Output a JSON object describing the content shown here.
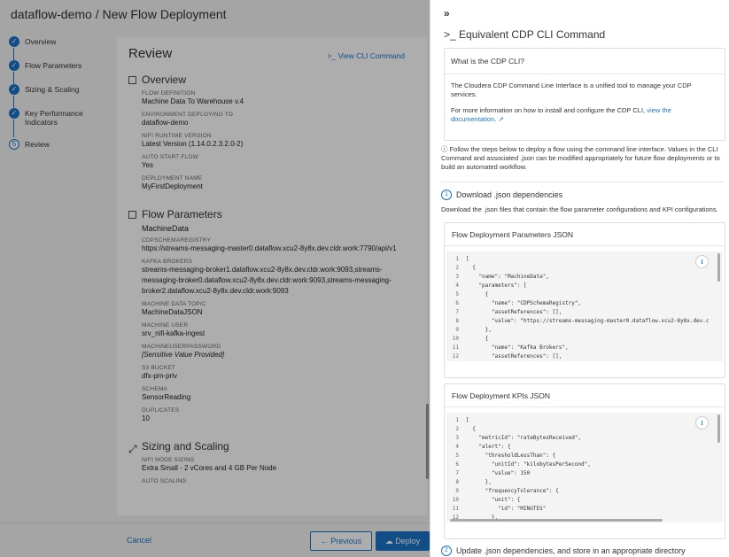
{
  "app": {
    "title": "dataflow-demo / New Flow Deployment",
    "steps": [
      {
        "label": "Overview",
        "state": "done"
      },
      {
        "label": "Flow Parameters",
        "state": "done"
      },
      {
        "label": "Sizing & Scaling",
        "state": "done"
      },
      {
        "label": "Key Performance Indicators",
        "state": "done"
      },
      {
        "label": "Review",
        "state": "current",
        "number": "5"
      }
    ],
    "review": {
      "title": "Review",
      "cli_link": "View CLI Command",
      "overview_title": "Overview",
      "overview_fields": [
        {
          "label": "FLOW DEFINITION",
          "value": "Machine Data To Warehouse v.4"
        },
        {
          "label": "ENVIRONMENT DEPLOYING TO",
          "value": "dataflow-demo"
        },
        {
          "label": "NIFI RUNTIME VERSION",
          "value": "Latest Version (1.14.0.2.3.2.0-2)"
        },
        {
          "label": "AUTO START FLOW",
          "value": "Yes"
        },
        {
          "label": "DEPLOYMENT NAME",
          "value": "MyFirstDeployment"
        }
      ],
      "params_title": "Flow Parameters",
      "params_group": "MachineData",
      "params_fields": [
        {
          "label": "CDPSCHEMAREGISTRY",
          "value": "https://streams-messaging-master0.dataflow.xcu2-8y8x.dev.cldr.work:7790/api/v1"
        },
        {
          "label": "KAFKA BROKERS",
          "value": "streams-messaging-broker1.dataflow.xcu2-8y8x.dev.cldr.work:9093,streams-messaging-broker0.dataflow.xcu2-8y8x.dev.cldr.work:9093,streams-messaging-broker2.dataflow.xcu2-8y8x.dev.cldr.work:9093"
        },
        {
          "label": "MACHINE DATA TOPIC",
          "value": "MachineDataJSON"
        },
        {
          "label": "MACHINE USER",
          "value": "srv_nifi-kafka-ingest"
        },
        {
          "label": "MACHINEUSERPASSWORD",
          "value": "[Sensitive Value Provided]"
        },
        {
          "label": "S3 BUCKET",
          "value": "dfx-pm-priv"
        },
        {
          "label": "SCHEMA",
          "value": "SensorReading"
        },
        {
          "label": "DUPLICATES",
          "value": "10"
        }
      ],
      "sizing_title": "Sizing and Scaling",
      "sizing_fields": [
        {
          "label": "NIFI NODE SIZING",
          "value": "Extra Small - 2 vCores and 4 GB Per Node"
        },
        {
          "label": "AUTO SCALING",
          "value": ""
        }
      ]
    },
    "footer": {
      "cancel": "Cancel",
      "previous": "Previous",
      "deploy": "Deploy"
    }
  },
  "drawer": {
    "collapse_icon": "»",
    "title": "Equivalent CDP CLI Command",
    "info_title": "What is the CDP CLI?",
    "info_text": "The Cloudera CDP Command Line Interface is a unified tool to manage your CDP services.",
    "info_more_prefix": "For more information on how to install and configure the CDP CLI,",
    "info_more_link": "view the documentation.",
    "follow_text": "Follow the steps below to deploy a flow using the command line interface. Values in the CLI Command and associated .json can be modified appropriately for future flow deployments or to build an automated workflow.",
    "step1_num": "1",
    "step1_title": "Download .json dependencies",
    "step1_text": "Download the .json files that contain the flow parameter configurations and KPI configurations.",
    "params_json_title": "Flow Deployment Parameters JSON",
    "params_json_lines": [
      "[",
      "  {",
      "    \"name\": \"MachineData\",",
      "    \"parameters\": [",
      "      {",
      "        \"name\": \"CDPSchemaRegistry\",",
      "        \"assetReferences\": [],",
      "        \"value\": \"https://streams-messaging-master0.dataflow.xcu2-8y8x.dev.c",
      "      },",
      "      {",
      "        \"name\": \"Kafka Brokers\",",
      "        \"assetReferences\": [],"
    ],
    "kpi_json_title": "Flow Deployment KPIs JSON",
    "kpi_json_lines": [
      "[",
      "  {",
      "    \"metricId\": \"rateBytesReceived\",",
      "    \"alert\": {",
      "      \"thresholdLessThan\": {",
      "        \"unitId\": \"kilobytesPerSecond\",",
      "        \"value\": 150",
      "      },",
      "      \"frequencyTolerance\": {",
      "        \"unit\": {",
      "          \"id\": \"MINUTES\"",
      "        },"
    ],
    "step2_num": "2",
    "step2_title": "Update .json dependencies, and store in an appropriate directory"
  }
}
